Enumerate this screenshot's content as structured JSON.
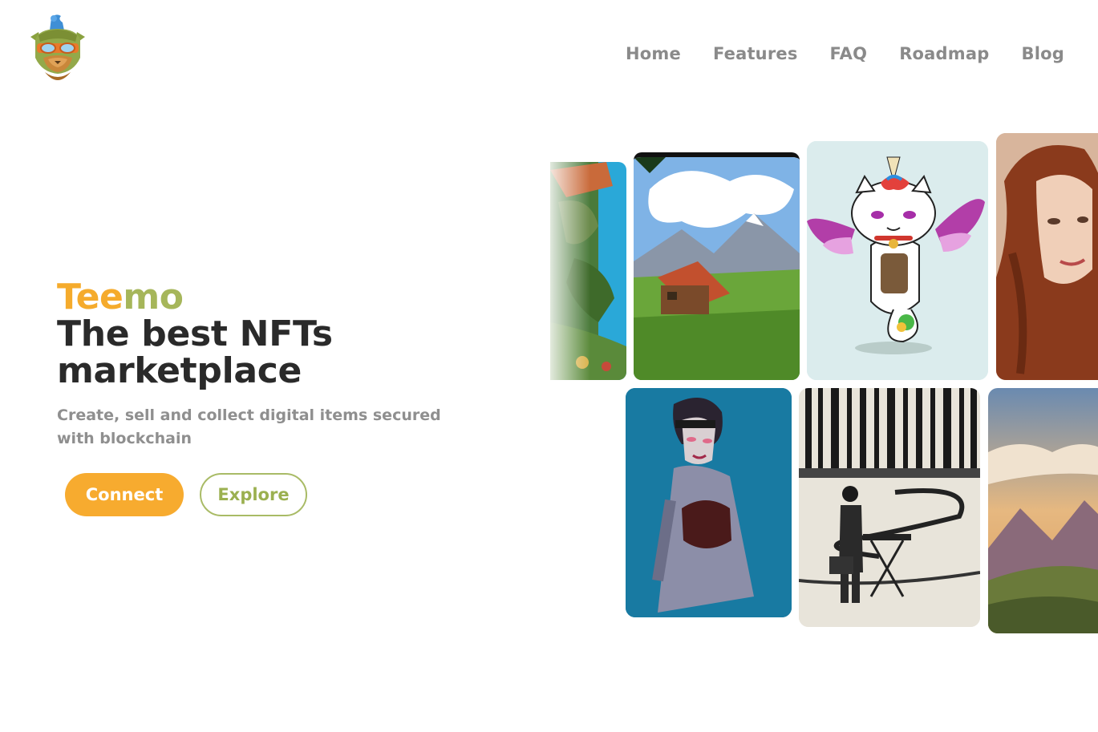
{
  "logo": {
    "icon": "teemo-mascot-icon"
  },
  "nav": {
    "items": [
      {
        "label": "Home"
      },
      {
        "label": "Features"
      },
      {
        "label": "FAQ"
      },
      {
        "label": "Roadmap"
      },
      {
        "label": "Blog"
      }
    ]
  },
  "hero": {
    "brand_part1": "Tee",
    "brand_part2": "mo",
    "headline": "The best NFTs marketplace",
    "subtitle": "Create, sell and collect digital items secured with blockchain",
    "connect_label": "Connect",
    "explore_label": "Explore"
  },
  "colors": {
    "accent_orange": "#f7ab2f",
    "accent_green": "#a6b65a",
    "heading": "#2a2a2a",
    "muted": "#8a8a8a"
  },
  "gallery": {
    "cards": [
      {
        "subject": "jungle-painting-image"
      },
      {
        "subject": "mountain-cabin-image"
      },
      {
        "subject": "unicorn-cat-image"
      },
      {
        "subject": "red-haired-portrait-image"
      },
      {
        "subject": "blue-portrait-woman-image"
      },
      {
        "subject": "man-at-keyboard-image"
      },
      {
        "subject": "mountain-sunset-image"
      }
    ]
  }
}
